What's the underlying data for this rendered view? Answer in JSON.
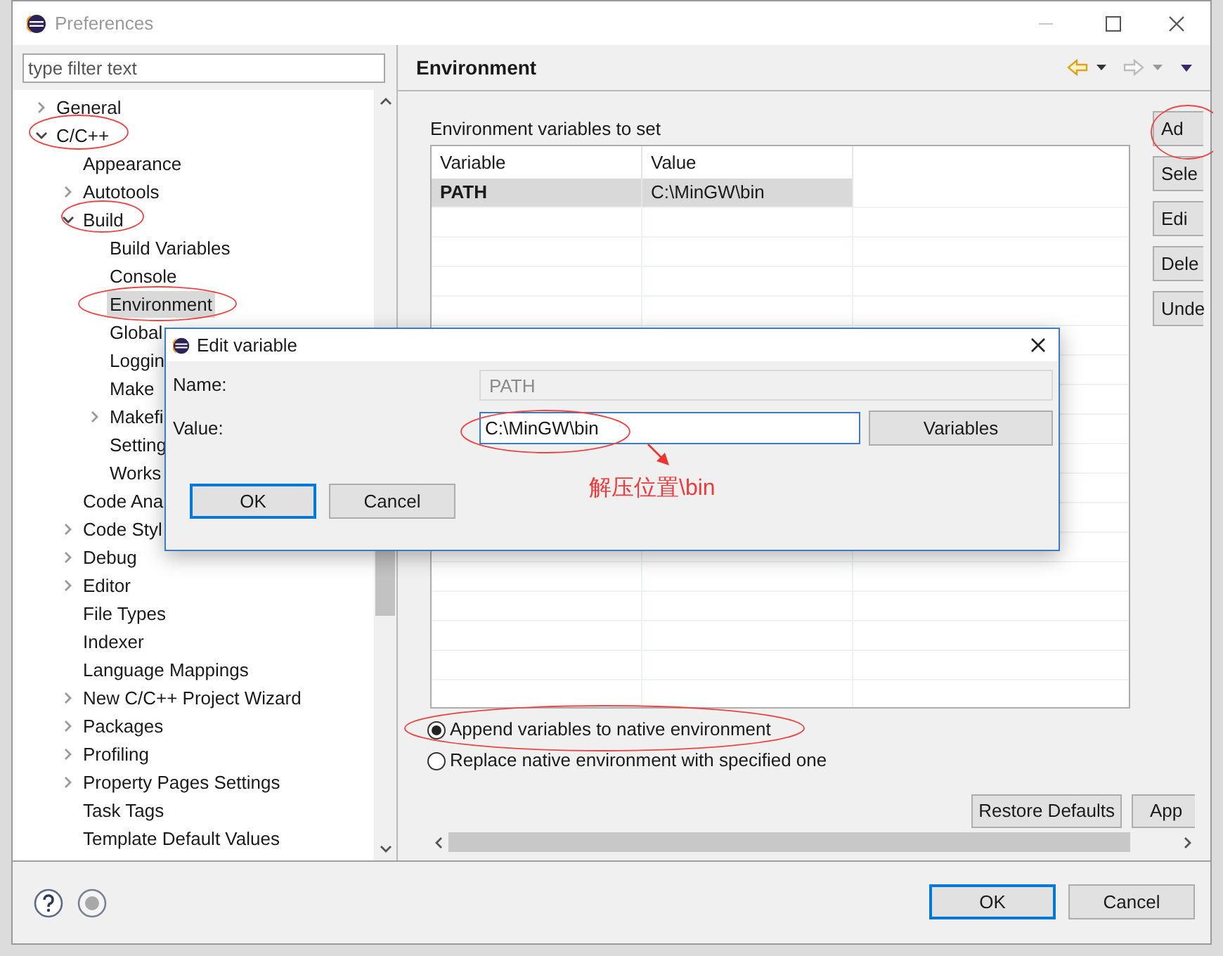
{
  "window": {
    "title": "Preferences"
  },
  "filter": {
    "placeholder": "type filter text"
  },
  "tree": [
    {
      "label": "General",
      "expanded": false,
      "selected": false
    },
    {
      "label": "C/C++",
      "expanded": true,
      "selected": false,
      "children": [
        {
          "label": "Appearance",
          "selected": false
        },
        {
          "label": "Autotools",
          "expanded": false,
          "selected": false
        },
        {
          "label": "Build",
          "expanded": true,
          "selected": false,
          "children": [
            {
              "label": "Build Variables",
              "selected": false
            },
            {
              "label": "Console",
              "selected": false
            },
            {
              "label": "Environment",
              "selected": true
            },
            {
              "label": "Global",
              "selected": false
            },
            {
              "label": "Loggin",
              "selected": false
            },
            {
              "label": "Make",
              "selected": false
            },
            {
              "label": "Makefi",
              "expanded": false,
              "selected": false
            },
            {
              "label": "Setting",
              "selected": false
            },
            {
              "label": "Works",
              "selected": false
            }
          ]
        },
        {
          "label": "Code Ana",
          "selected": false
        },
        {
          "label": "Code Styl",
          "expanded": false,
          "selected": false
        },
        {
          "label": "Debug",
          "expanded": false,
          "selected": false
        },
        {
          "label": "Editor",
          "expanded": false,
          "selected": false
        },
        {
          "label": "File Types",
          "selected": false
        },
        {
          "label": "Indexer",
          "selected": false
        },
        {
          "label": "Language Mappings",
          "selected": false
        },
        {
          "label": "New C/C++ Project Wizard",
          "expanded": false,
          "selected": false
        },
        {
          "label": "Packages",
          "expanded": false,
          "selected": false
        },
        {
          "label": "Profiling",
          "expanded": false,
          "selected": false
        },
        {
          "label": "Property Pages Settings",
          "expanded": false,
          "selected": false
        },
        {
          "label": "Task Tags",
          "selected": false
        },
        {
          "label": "Template Default Values",
          "selected": false
        }
      ]
    }
  ],
  "page": {
    "title": "Environment",
    "table_label": "Environment variables to set",
    "table": {
      "columns": [
        "Variable",
        "Value"
      ],
      "rows": [
        {
          "variable": "PATH",
          "value": "C:\\MinGW\\bin",
          "selected": true
        }
      ]
    },
    "side_buttons": [
      "Ad",
      "Sele",
      "Edi",
      "Dele",
      "Unde"
    ],
    "options": [
      {
        "label": "Append variables to native environment",
        "selected": true
      },
      {
        "label": "Replace native environment with specified one",
        "selected": false
      }
    ],
    "restore_button": "Restore Defaults",
    "apply_button": "App"
  },
  "footer": {
    "buttons": [
      {
        "label": "OK",
        "default": true
      },
      {
        "label": "Cancel",
        "default": false
      }
    ]
  },
  "dialog": {
    "title": "Edit variable",
    "name_label": "Name:",
    "name_value": "PATH",
    "name_disabled": true,
    "value_label": "Value:",
    "value": "C:\\MinGW\\bin",
    "variables_button": "Variables",
    "buttons": [
      {
        "label": "OK",
        "default": true
      },
      {
        "label": "Cancel",
        "default": false
      }
    ]
  },
  "annotation": {
    "note": "解压位置\\bin"
  }
}
